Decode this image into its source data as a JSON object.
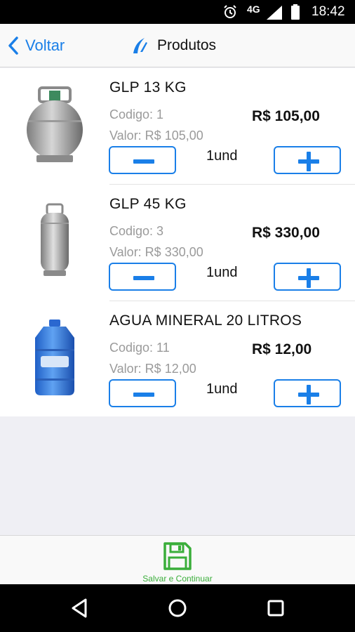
{
  "status_bar": {
    "network": "4G",
    "time": "18:42"
  },
  "nav": {
    "back_label": "Voltar",
    "title": "Produtos",
    "accent_color": "#1a7fe8"
  },
  "products": [
    {
      "name": "GLP 13 KG",
      "code": "Codigo: 1",
      "valor": "Valor: R$ 105,00",
      "price": "R$ 105,00",
      "qty": "1und",
      "image": "gas-cylinder-13kg"
    },
    {
      "name": "GLP 45 KG",
      "code": "Codigo: 3",
      "valor": "Valor: R$ 330,00",
      "price": "R$ 330,00",
      "qty": "1und",
      "image": "gas-cylinder-45kg"
    },
    {
      "name": "AGUA MINERAL 20 LITROS",
      "code": "Codigo: 11",
      "valor": "Valor: R$ 12,00",
      "price": "R$ 12,00",
      "qty": "1und",
      "image": "water-jug-20l"
    }
  ],
  "footer": {
    "save_label": "Salvar e Continuar",
    "save_color": "#3aae3a"
  },
  "icons": {
    "minus": "minus-icon",
    "plus": "plus-icon",
    "save": "floppy-disk-icon"
  }
}
